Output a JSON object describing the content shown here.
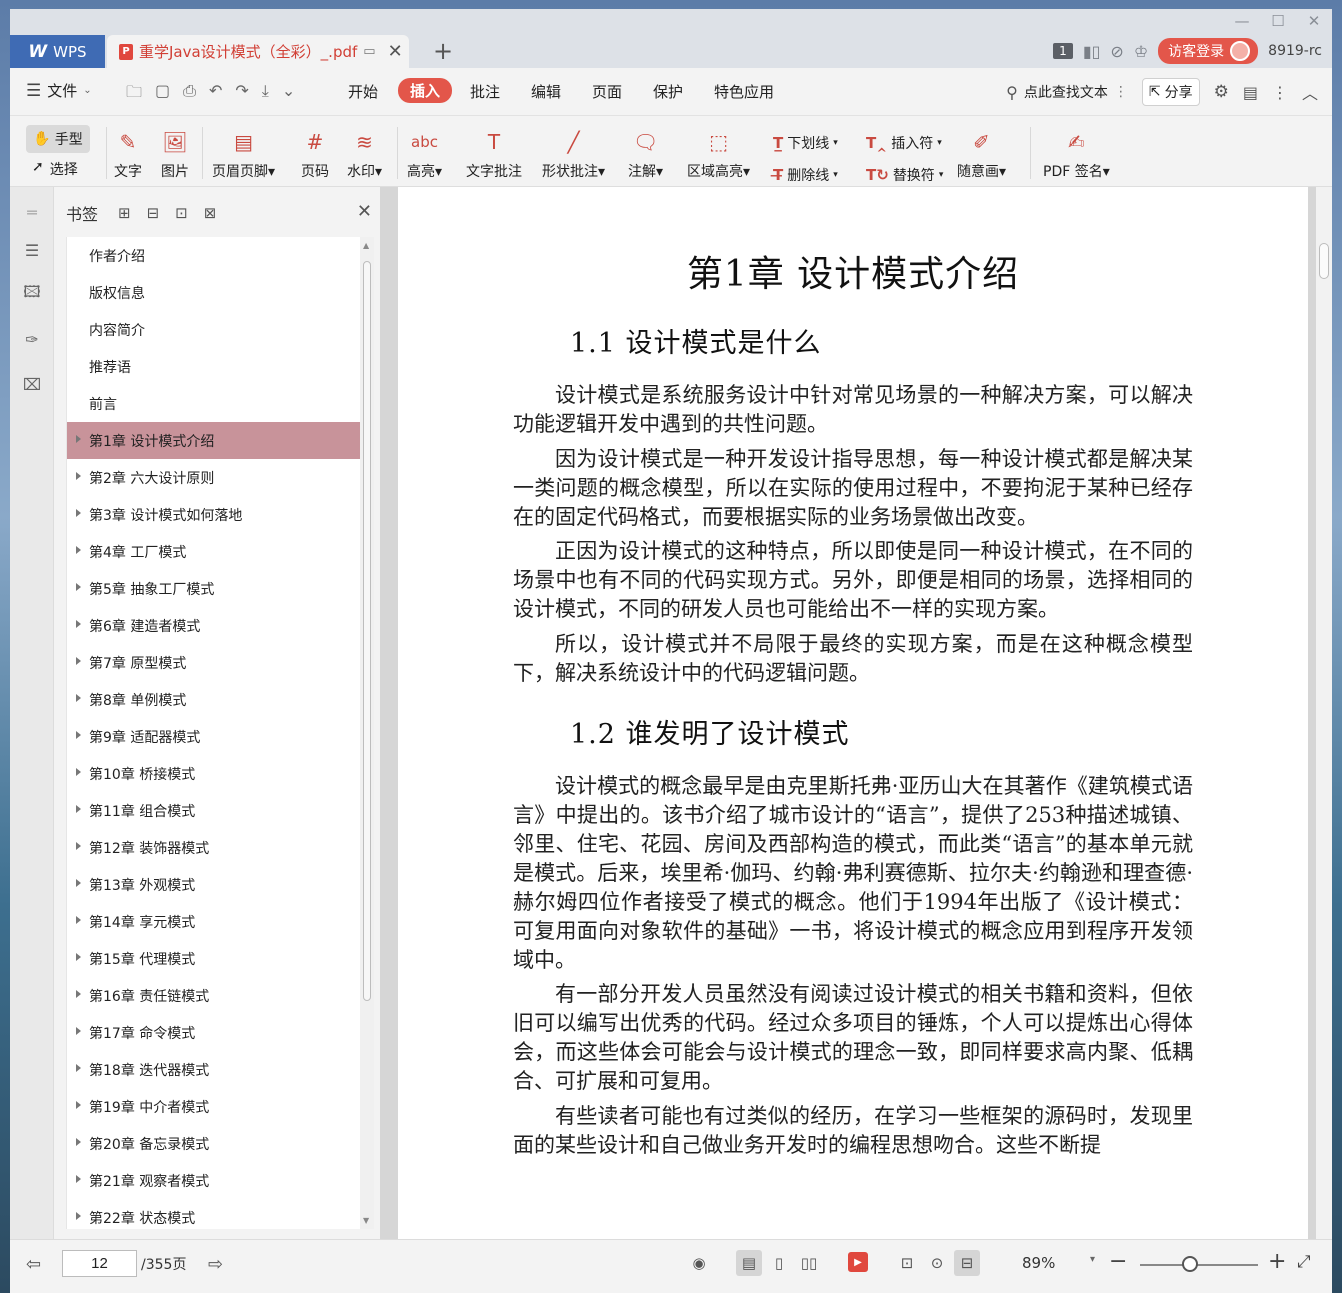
{
  "window": {
    "wps_label": "WPS",
    "doc_tab_title": "重学Java设计模式（全彩）_.pdf",
    "page_badge": "1",
    "login_label": "访客登录",
    "user_id": "8919-rc"
  },
  "menu": {
    "file": "文件",
    "items": [
      "开始",
      "插入",
      "批注",
      "编辑",
      "页面",
      "保护",
      "特色应用"
    ],
    "active": "插入",
    "search_text": "点此查找文本",
    "share": "分享"
  },
  "toolbar": {
    "hand": "手型",
    "select": "选择",
    "text": "文字",
    "image": "图片",
    "header_footer": "页眉页脚",
    "page_num": "页码",
    "watermark": "水印",
    "highlight": "高亮",
    "text_comment": "文字批注",
    "shape_comment": "形状批注",
    "annotation": "注解",
    "area_highlight": "区域高亮",
    "underline": "下划线",
    "strikethrough": "删除线",
    "insert_mark": "插入符",
    "replace_mark": "替换符",
    "freehand": "随意画",
    "pdf_sign": "PDF 签名"
  },
  "bookmarks": {
    "title": "书签",
    "items": [
      {
        "label": "作者介绍",
        "expandable": false
      },
      {
        "label": "版权信息",
        "expandable": false
      },
      {
        "label": "内容简介",
        "expandable": false
      },
      {
        "label": "推荐语",
        "expandable": false
      },
      {
        "label": "前言",
        "expandable": false
      },
      {
        "label": "第1章 设计模式介绍",
        "expandable": true,
        "selected": true
      },
      {
        "label": "第2章 六大设计原则",
        "expandable": true
      },
      {
        "label": "第3章 设计模式如何落地",
        "expandable": true
      },
      {
        "label": "第4章 工厂模式",
        "expandable": true
      },
      {
        "label": "第5章 抽象工厂模式",
        "expandable": true
      },
      {
        "label": "第6章 建造者模式",
        "expandable": true
      },
      {
        "label": "第7章 原型模式",
        "expandable": true
      },
      {
        "label": "第8章 单例模式",
        "expandable": true
      },
      {
        "label": "第9章 适配器模式",
        "expandable": true
      },
      {
        "label": "第10章 桥接模式",
        "expandable": true
      },
      {
        "label": "第11章 组合模式",
        "expandable": true
      },
      {
        "label": "第12章 装饰器模式",
        "expandable": true
      },
      {
        "label": "第13章 外观模式",
        "expandable": true
      },
      {
        "label": "第14章 享元模式",
        "expandable": true
      },
      {
        "label": "第15章 代理模式",
        "expandable": true
      },
      {
        "label": "第16章 责任链模式",
        "expandable": true
      },
      {
        "label": "第17章 命令模式",
        "expandable": true
      },
      {
        "label": "第18章 迭代器模式",
        "expandable": true
      },
      {
        "label": "第19章 中介者模式",
        "expandable": true
      },
      {
        "label": "第20章 备忘录模式",
        "expandable": true
      },
      {
        "label": "第21章 观察者模式",
        "expandable": true
      },
      {
        "label": "第22章 状态模式",
        "expandable": true
      }
    ]
  },
  "document": {
    "chapter_title": "第1章  设计模式介绍",
    "section1_title": "1.1  设计模式是什么",
    "section1_paras": [
      "设计模式是系统服务设计中针对常见场景的一种解决方案，可以解决功能逻辑开发中遇到的共性问题。",
      "因为设计模式是一种开发设计指导思想，每一种设计模式都是解决某一类问题的概念模型，所以在实际的使用过程中，不要拘泥于某种已经存在的固定代码格式，而要根据实际的业务场景做出改变。",
      "正因为设计模式的这种特点，所以即使是同一种设计模式，在不同的场景中也有不同的代码实现方式。另外，即便是相同的场景，选择相同的设计模式，不同的研发人员也可能给出不一样的实现方案。",
      "所以，设计模式并不局限于最终的实现方案，而是在这种概念模型下，解决系统设计中的代码逻辑问题。"
    ],
    "section2_title": "1.2  谁发明了设计模式",
    "section2_paras": [
      "设计模式的概念最早是由克里斯托弗·亚历山大在其著作《建筑模式语言》中提出的。该书介绍了城市设计的“语言”，提供了253种描述城镇、邻里、住宅、花园、房间及西部构造的模式，而此类“语言”的基本单元就是模式。后来，埃里希·伽玛、约翰·弗利赛德斯、拉尔夫·约翰逊和理查德·赫尔姆四位作者接受了模式的概念。他们于1994年出版了《设计模式：可复用面向对象软件的基础》一书，将设计模式的概念应用到程序开发领域中。",
      "有一部分开发人员虽然没有阅读过设计模式的相关书籍和资料，但依旧可以编写出优秀的代码。经过众多项目的锤炼，个人可以提炼出心得体会，而这些体会可能会与设计模式的理念一致，即同样要求高内聚、低耦合、可扩展和可复用。",
      "有些读者可能也有过类似的经历，在学习一些框架的源码时，发现里面的某些设计和自己做业务开发时的编程思想吻合。这些不断提"
    ]
  },
  "status": {
    "current_page": "12",
    "total_pages": "/355页",
    "zoom": "89%",
    "zoom_fraction": 0.42
  }
}
